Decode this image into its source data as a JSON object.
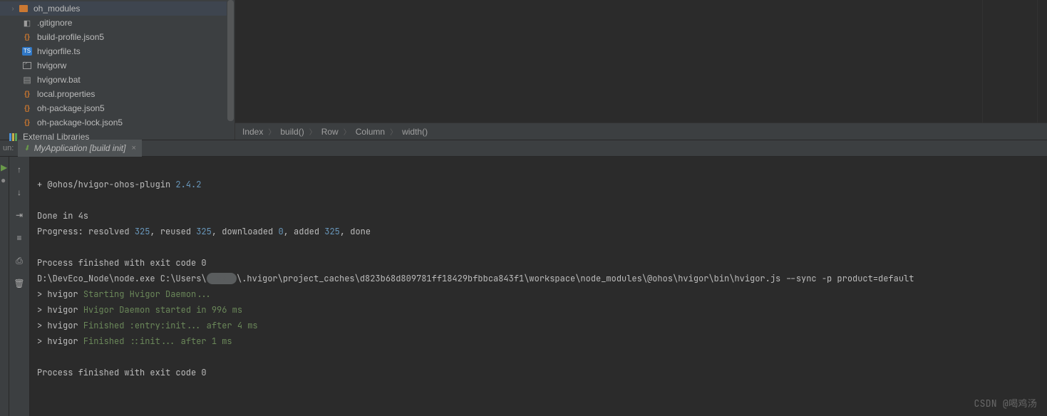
{
  "project": {
    "items": [
      {
        "name": "oh_modules",
        "type": "folder",
        "expanded": true
      },
      {
        "name": ".gitignore",
        "type": "git"
      },
      {
        "name": "build-profile.json5",
        "type": "json"
      },
      {
        "name": "hvigorfile.ts",
        "type": "ts"
      },
      {
        "name": "hvigorw",
        "type": "term"
      },
      {
        "name": "hvigorw.bat",
        "type": "bat"
      },
      {
        "name": "local.properties",
        "type": "json"
      },
      {
        "name": "oh-package.json5",
        "type": "json"
      },
      {
        "name": "oh-package-lock.json5",
        "type": "json"
      }
    ],
    "external_libraries": "External Libraries"
  },
  "breadcrumb": [
    "Index",
    "build()",
    "Row",
    "Column",
    "width()"
  ],
  "run": {
    "label": "un:",
    "tab": "MyApplication [build init]"
  },
  "console": {
    "line1_a": "+ @ohos/hvigor-ohos-plugin ",
    "line1_b": "2.4.2",
    "done": "Done in 4s",
    "progress_a": "Progress: resolved ",
    "progress_b": "325",
    "progress_c": ", reused ",
    "progress_d": "325",
    "progress_e": ", downloaded ",
    "progress_f": "0",
    "progress_g": ", added ",
    "progress_h": "325",
    "progress_i": ", done",
    "exit1": "Process finished with exit code 0",
    "cmd_a": "D:\\DevEco_Node\\node.exe C:\\Users\\",
    "cmd_b": "\\.hvigor\\project_caches\\d823b68d809781ff18429bfbbca843f1\\workspace\\node_modules\\@ohos\\hvigor\\bin\\hvigor.js --sync -p product=default",
    "hv1_a": "> hvigor ",
    "hv1_b": "Starting Hvigor Daemon...",
    "hv2_a": "> hvigor ",
    "hv2_b": "Hvigor Daemon started in 996 ms",
    "hv3_a": "> hvigor ",
    "hv3_b": "Finished :entry:init... after 4 ms",
    "hv4_a": "> hvigor ",
    "hv4_b": "Finished ::init... after 1 ms",
    "exit2": "Process finished with exit code 0"
  },
  "watermark": "CSDN @喝鸡汤"
}
